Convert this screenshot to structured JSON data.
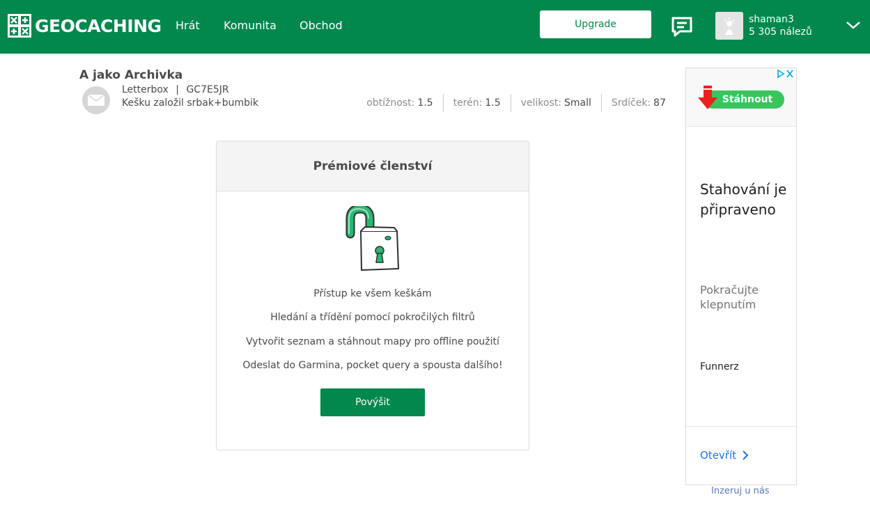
{
  "header": {
    "logo_text": "GEOCACHING",
    "nav": [
      "Hrát",
      "Komunita",
      "Obchod"
    ],
    "upgrade_label": "Upgrade",
    "user": {
      "name": "shaman3",
      "finds": "5 305 nálezů"
    }
  },
  "cache": {
    "title": "A jako Archivka",
    "type": "Letterbox",
    "separator": "|",
    "code": "GC7E5JR",
    "owner_line": "Kešku založil srbak+bumbik",
    "stats": [
      {
        "label": "obtížnost:",
        "value": "1.5"
      },
      {
        "label": "terén:",
        "value": "1.5"
      },
      {
        "label": "velikost:",
        "value": "Small"
      },
      {
        "label": "Srdíček:",
        "value": "87"
      }
    ]
  },
  "premium": {
    "title": "Prémiové členství",
    "features": [
      "Přístup ke všem keškám",
      "Hledání a třídění pomocí pokročilých filtrů",
      "Vytvořit seznam a stáhnout mapy pro offline použití",
      "Odeslat do Garmina, pocket query a spousta dalšího!"
    ],
    "button_label": "Povýšit"
  },
  "ad": {
    "download_label": "Stáhnout",
    "headline": "Stahování je připraveno",
    "subtext": "Pokračujte klepnutím",
    "brand": "Funnerz",
    "open_label": "Otevřít",
    "advertise_link": "Inzeruj u nás"
  },
  "colors": {
    "brand_green": "#02874d",
    "lock_green": "#2bb673",
    "ad_link_blue": "#1a73e8"
  }
}
